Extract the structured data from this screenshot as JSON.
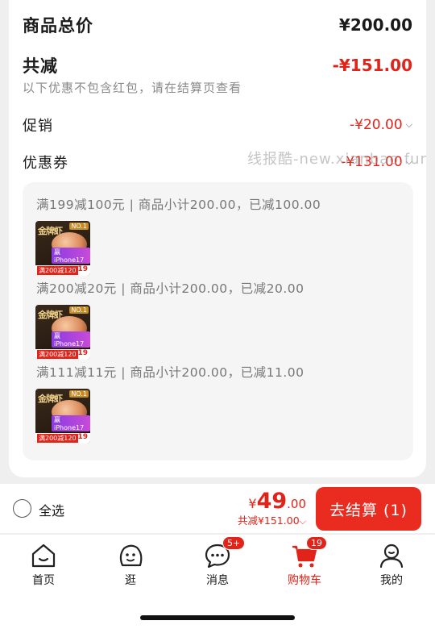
{
  "summary": {
    "total_label": "商品总价",
    "total_value": "¥200.00",
    "discount_label": "共减",
    "discount_value": "-¥151.00",
    "note": "以下优惠不包含红包，请在结算页查看",
    "promo_label": "促销",
    "promo_value": "-¥20.00",
    "coupon_label": "优惠券",
    "coupon_value": "-¥131.00"
  },
  "watermark": "线报酷-new.xianbao.fun",
  "promotions": [
    {
      "text": "满199减100元 | 商品小计200.00，已减100.00"
    },
    {
      "text": "满200减20元 | 商品小计200.00，已减20.00"
    },
    {
      "text": "满111减11元 | 商品小计200.00，已减11.00"
    }
  ],
  "product_thumb": {
    "brand": "金牌虾",
    "badge": "NO.1",
    "tag": "赢iPhone17",
    "promo": "满200减120",
    "price": "19"
  },
  "bottom_bar": {
    "select_all": "全选",
    "yen": "¥",
    "amount_int": "49",
    "amount_dec": ".00",
    "discount_note": "共减¥151.00",
    "checkout": "去结算 (1)"
  },
  "tabbar": {
    "items": [
      {
        "label": "首页",
        "icon": "home-icon"
      },
      {
        "label": "逛",
        "icon": "browse-face-icon"
      },
      {
        "label": "消息",
        "icon": "message-icon",
        "badge": "5+"
      },
      {
        "label": "购物车",
        "icon": "cart-icon",
        "badge": "19",
        "active": true
      },
      {
        "label": "我的",
        "icon": "profile-icon"
      }
    ]
  },
  "colors": {
    "accent": "#e2231a",
    "checkout_bg": "#ea2b20"
  }
}
